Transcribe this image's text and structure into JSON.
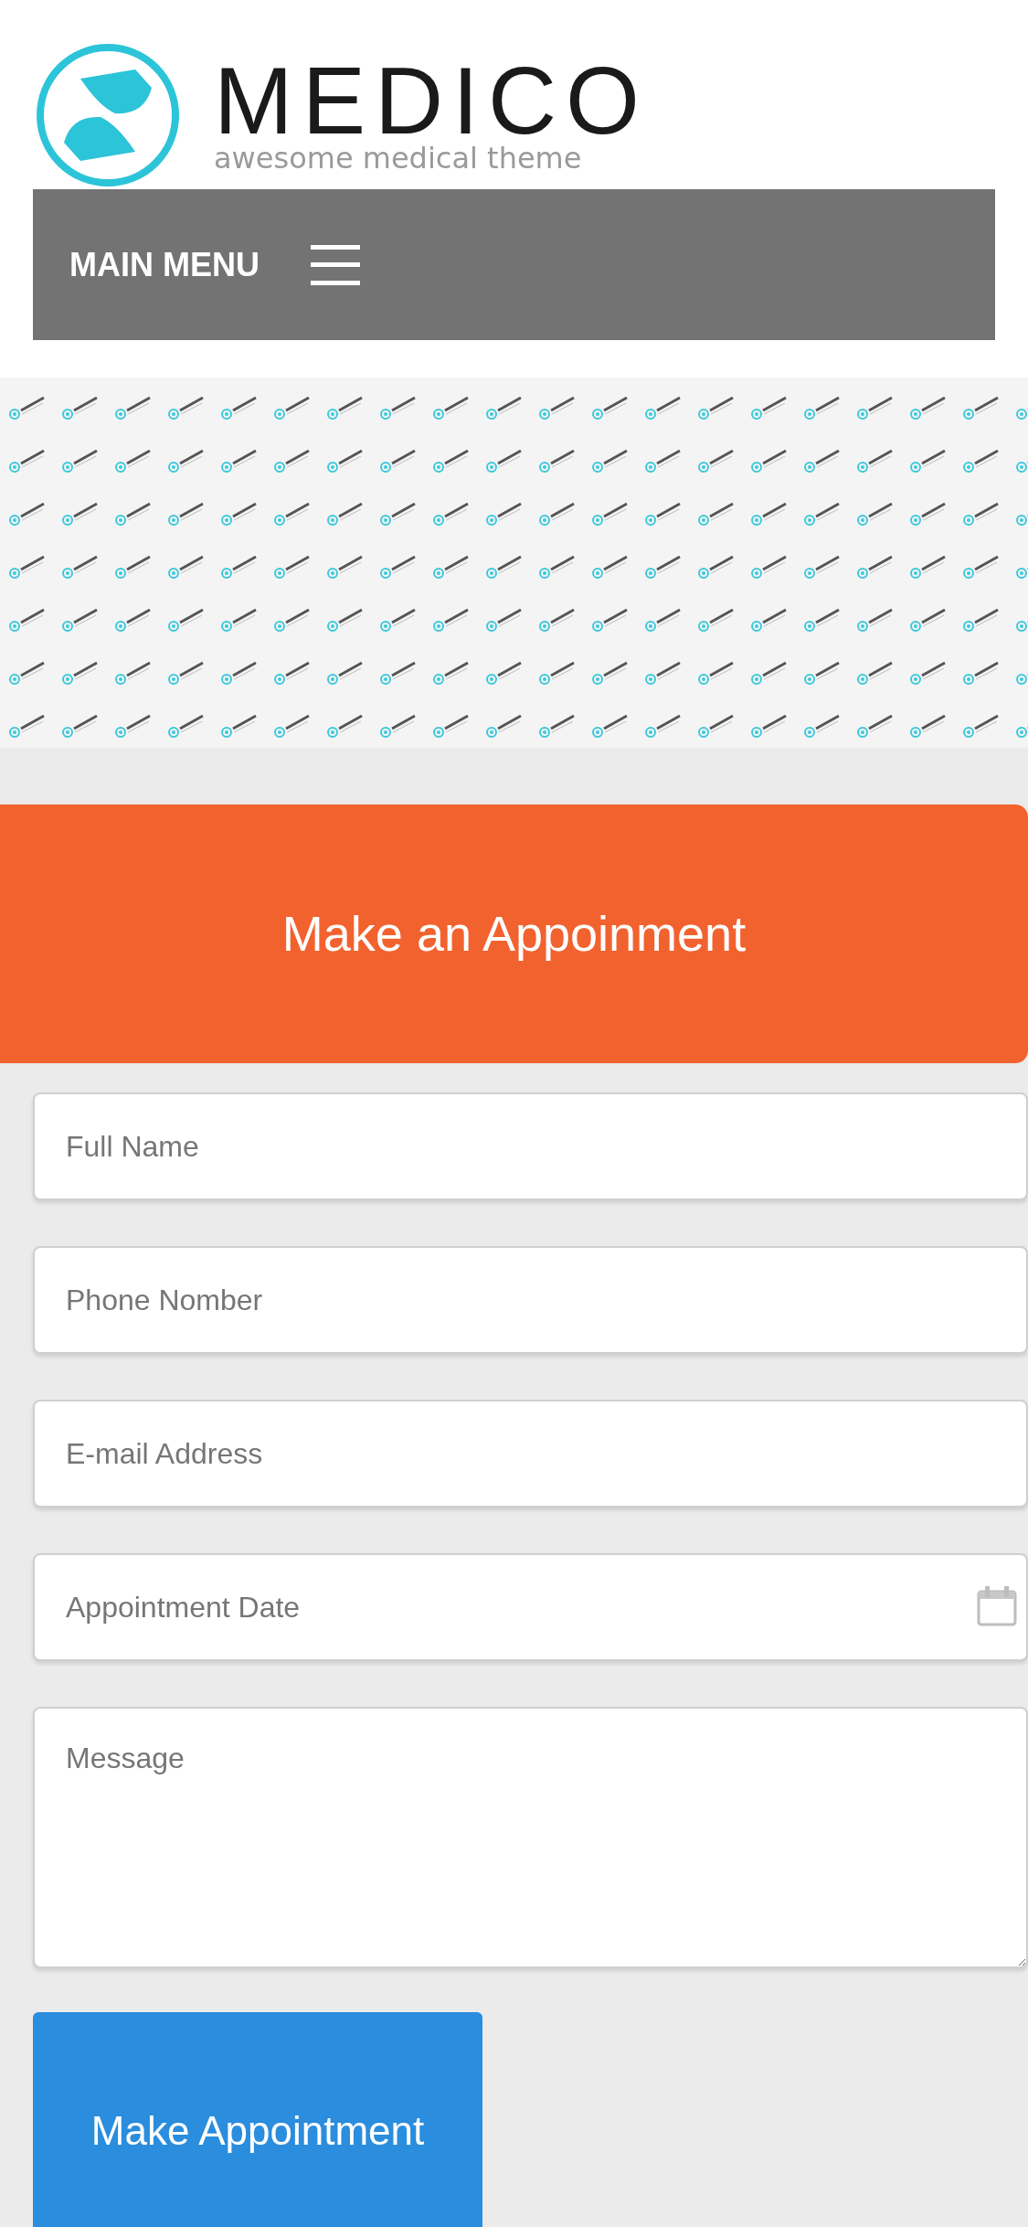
{
  "header": {
    "logo": {
      "title": "MEDICO",
      "tagline": "awesome medical theme"
    }
  },
  "nav": {
    "label": "MAIN MENU"
  },
  "form": {
    "title": "Make an Appoinment",
    "fields": [
      {
        "kind": "text",
        "placeholder": "Full Name"
      },
      {
        "kind": "text",
        "placeholder": "Phone Nomber"
      },
      {
        "kind": "text",
        "placeholder": "E-mail Address"
      },
      {
        "kind": "date",
        "placeholder": "Appointment Date"
      },
      {
        "kind": "textarea",
        "placeholder": "Message"
      }
    ],
    "submit": "Make Appointment"
  }
}
